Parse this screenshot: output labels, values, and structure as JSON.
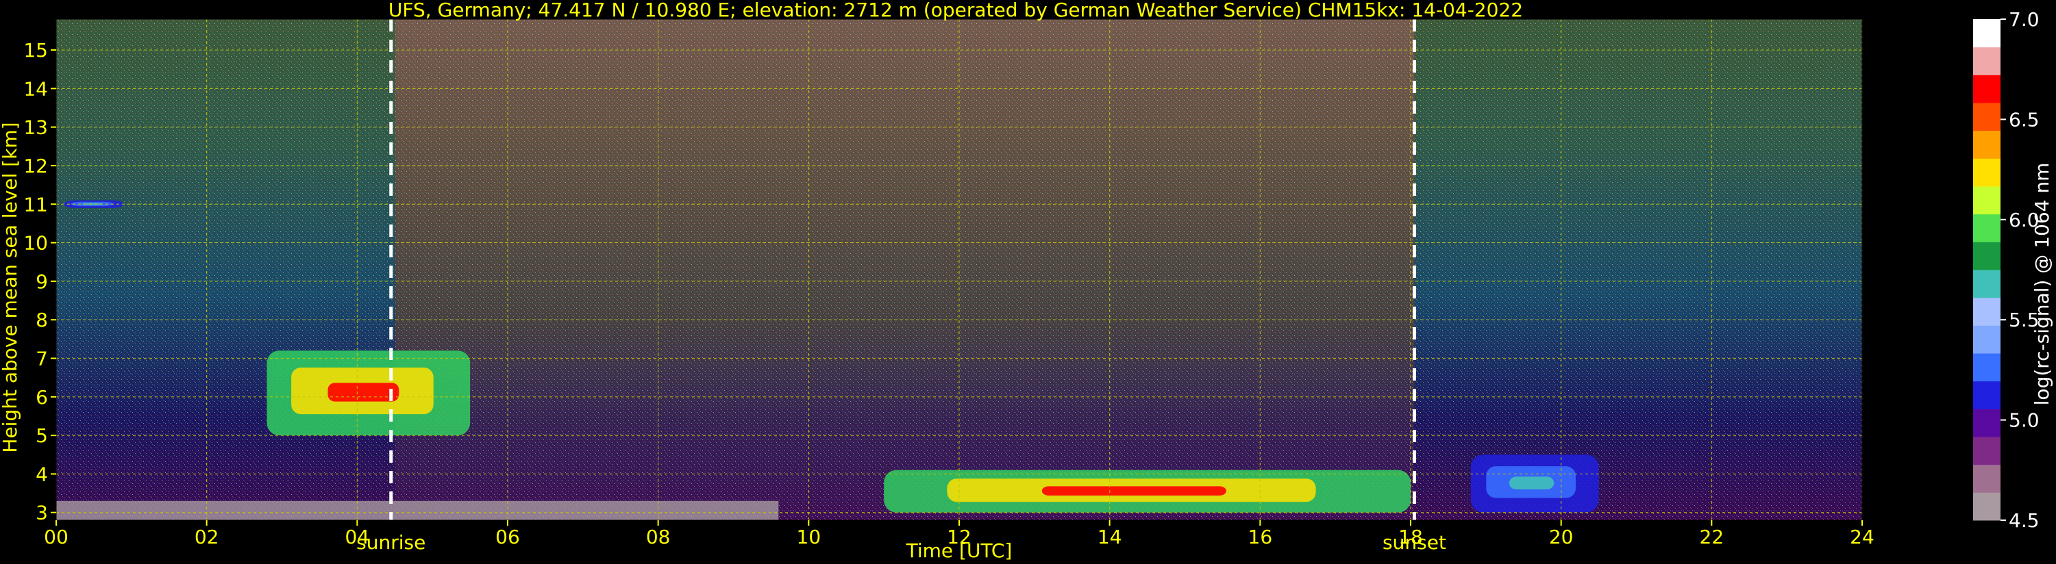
{
  "chart_data": {
    "type": "heatmap",
    "title": "UFS, Germany; 47.417 N / 10.980 E; elevation: 2712 m  (operated by German Weather Service)    CHM15kx: 14-04-2022",
    "xlabel": "Time [UTC]",
    "ylabel": "Height above mean sea level [km]",
    "xlim": [
      0,
      24
    ],
    "ylim": [
      2.8,
      15.8
    ],
    "x_ticks": [
      "00",
      "02",
      "04",
      "06",
      "08",
      "10",
      "12",
      "14",
      "16",
      "18",
      "20",
      "22",
      "24"
    ],
    "y_ticks": [
      "3",
      "4",
      "5",
      "6",
      "7",
      "8",
      "9",
      "10",
      "11",
      "12",
      "13",
      "14",
      "15"
    ],
    "grid": true,
    "annotations": [
      {
        "label": "sunrise",
        "x": 4.45
      },
      {
        "label": "sunset",
        "x": 18.05
      }
    ],
    "colorbar": {
      "label": "log(rc-signal) @ 1064 nm",
      "range": [
        4.5,
        7.0
      ],
      "ticks": [
        "4.5",
        "5.0",
        "5.5",
        "6.0",
        "6.5",
        "7.0"
      ]
    },
    "features": [
      {
        "kind": "cloud",
        "x": [
          2.8,
          5.5
        ],
        "y": [
          5.0,
          7.2
        ],
        "level": "high"
      },
      {
        "kind": "cloud",
        "x": [
          0.1,
          0.9
        ],
        "y": [
          10.9,
          11.1
        ],
        "level": "medium"
      },
      {
        "kind": "boundary-layer",
        "x": [
          11.0,
          18.0
        ],
        "y": [
          3.0,
          4.1
        ],
        "level": "high"
      },
      {
        "kind": "boundary-layer",
        "x": [
          18.8,
          20.5
        ],
        "y": [
          3.0,
          4.5
        ],
        "level": "medium"
      }
    ]
  },
  "colors": {
    "axis_text": "#ffff00",
    "grid": "#c8c800",
    "marker_lines": "#ffffff",
    "colormap": [
      "#a89aa0",
      "#a07090",
      "#802a88",
      "#5a0aa0",
      "#2020e0",
      "#3a70ff",
      "#80a8ff",
      "#a8c0ff",
      "#40c0b8",
      "#1a9a40",
      "#50e050",
      "#c8ff30",
      "#ffe000",
      "#ffa000",
      "#ff5000",
      "#ff0000",
      "#f0a8a8",
      "#ffffff"
    ]
  }
}
